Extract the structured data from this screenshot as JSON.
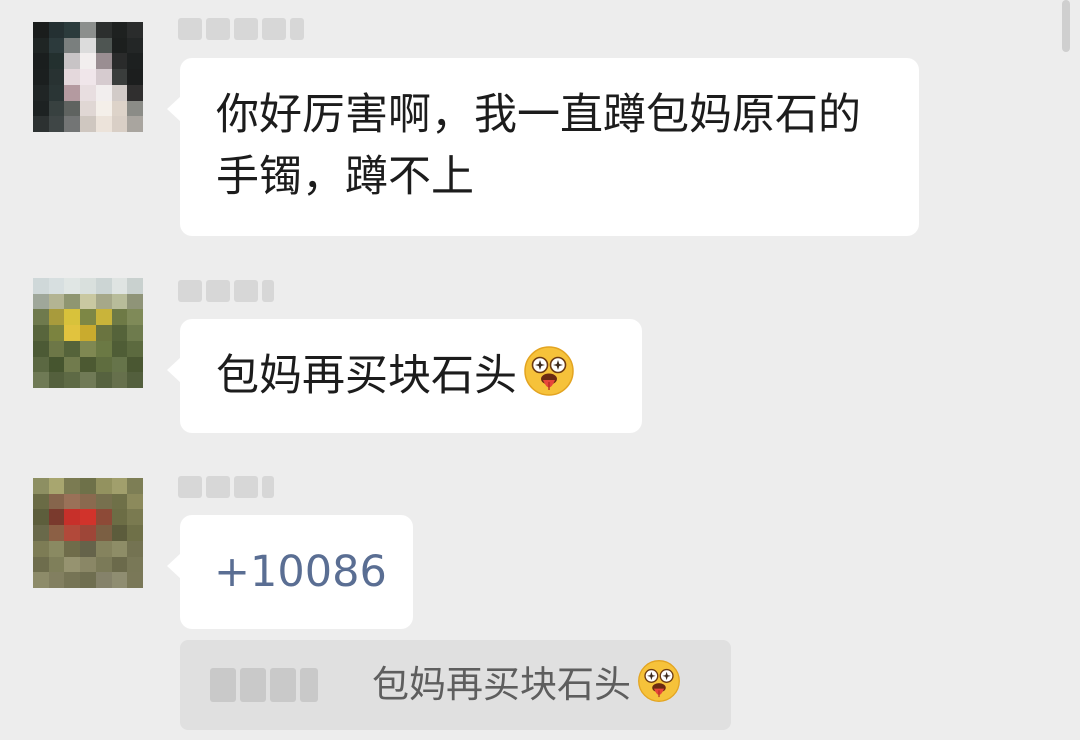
{
  "messages": [
    {
      "text": "你好厉害啊，我一直蹲包妈原石的手镯，蹲不上",
      "avatar_colors": [
        "#1a1d1c",
        "#243032",
        "#2b3b3c",
        "#8c8f8d",
        "#2c2f2e",
        "#1e2120",
        "#2a2c2c",
        "#1f2524",
        "#2c3a3c",
        "#7a7f7e",
        "#dcdcdc",
        "#4e5552",
        "#1c1f1e",
        "#232626",
        "#1a1e1e",
        "#23302f",
        "#c8c4c6",
        "#f2eeee",
        "#9a8e92",
        "#2a2b2b",
        "#1d2020",
        "#1b1f1f",
        "#283232",
        "#e4d8dc",
        "#f0e6ea",
        "#d6cbcf",
        "#3a3d3c",
        "#1c1e1e",
        "#202525",
        "#2a3535",
        "#b49aa0",
        "#e8dee0",
        "#f2eeee",
        "#d2cbc8",
        "#302f2f",
        "#1d2222",
        "#384140",
        "#5f6360",
        "#e0d7d4",
        "#f4efe9",
        "#ddd3c9",
        "#8b8c87",
        "#2c3131",
        "#3f4646",
        "#737575",
        "#cfc7c0",
        "#ece3da",
        "#d9cfc6",
        "#a9a59f"
      ]
    },
    {
      "text": "包妈再买块石头",
      "emoji": "tongue-out-emoji",
      "avatar_colors": [
        "#cfd8d9",
        "#d7dfe0",
        "#e0e6e4",
        "#d9e0dd",
        "#ccd5d4",
        "#dfe4e2",
        "#c9d1cf",
        "#9fa79a",
        "#b3b493",
        "#8f9671",
        "#c9c8a1",
        "#a6a889",
        "#b8bc9a",
        "#8f9478",
        "#6f7a4d",
        "#a89b3c",
        "#d8c23b",
        "#7d8745",
        "#c9b43a",
        "#6e7a46",
        "#7f8a58",
        "#58653c",
        "#7b833f",
        "#e1c33e",
        "#c9ab2e",
        "#6a7440",
        "#55633a",
        "#6e7b4d",
        "#4c5a35",
        "#6d7747",
        "#55633a",
        "#7f8852",
        "#6b7944",
        "#4f5d36",
        "#5c6a3f",
        "#5b6842",
        "#46552f",
        "#717b4d",
        "#4c5932",
        "#5f6d3f",
        "#66744a",
        "#4a5732",
        "#6f7a55",
        "#54603d",
        "#5e6a45",
        "#707a56",
        "#56623f",
        "#66704c",
        "#535f3d"
      ]
    },
    {
      "text": "+10086",
      "avatar_colors": [
        "#8d8f62",
        "#a8a66f",
        "#7b7b52",
        "#6e7149",
        "#93925f",
        "#a19f6c",
        "#7d7e55",
        "#6a6b45",
        "#86654c",
        "#9a7158",
        "#8a6a4f",
        "#77704e",
        "#6f7048",
        "#8c8a5c",
        "#5d5e3c",
        "#7a3a2d",
        "#c7302a",
        "#d1332b",
        "#8d4a37",
        "#6c6d45",
        "#7a7a50",
        "#69694a",
        "#8c6045",
        "#b2493a",
        "#9e4638",
        "#7b5f43",
        "#5c5c3c",
        "#6f7048",
        "#7d7c55",
        "#8a8a62",
        "#6f6c4a",
        "#65634a",
        "#85835e",
        "#8e8d67",
        "#747352",
        "#6e6d4d",
        "#7f7f5a",
        "#969370",
        "#8a8766",
        "#7b7a58",
        "#6b6a4b",
        "#797857",
        "#8d8b69",
        "#827f60",
        "#767455",
        "#6f6e50",
        "#85826a",
        "#8f8d71",
        "#7a7858"
      ]
    }
  ],
  "quote": {
    "text": "包妈再买块石头",
    "emoji": "tongue-out-emoji"
  },
  "colors": {
    "background": "#ededed",
    "bubble": "#ffffff",
    "number_link": "#5a6e93",
    "quote_background": "#e0e0e0",
    "quote_text": "#5e5e5e"
  }
}
